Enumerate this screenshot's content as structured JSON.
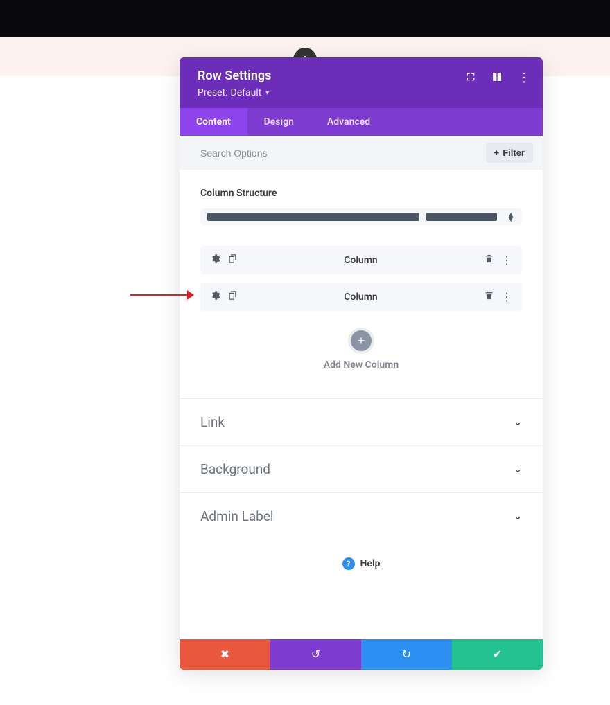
{
  "header": {
    "title": "Row Settings",
    "preset_prefix": "Preset:",
    "preset_value": "Default"
  },
  "tabs": {
    "content": "Content",
    "design": "Design",
    "advanced": "Advanced"
  },
  "search": {
    "placeholder": "Search Options",
    "filter_label": "Filter"
  },
  "structure": {
    "label": "Column Structure"
  },
  "columns": [
    {
      "label": "Column"
    },
    {
      "label": "Column"
    }
  ],
  "add_column": {
    "label": "Add New Column"
  },
  "accordion": {
    "link": "Link",
    "background": "Background",
    "admin_label": "Admin Label"
  },
  "help": {
    "label": "Help"
  },
  "colors": {
    "header_bg": "#6c2eb9",
    "tab_bg": "#7e3bd0",
    "tab_active_bg": "#8e44ec",
    "cancel": "#e9573f",
    "undo": "#7e3bd0",
    "redo": "#2c8ef0",
    "save": "#23c28e"
  }
}
